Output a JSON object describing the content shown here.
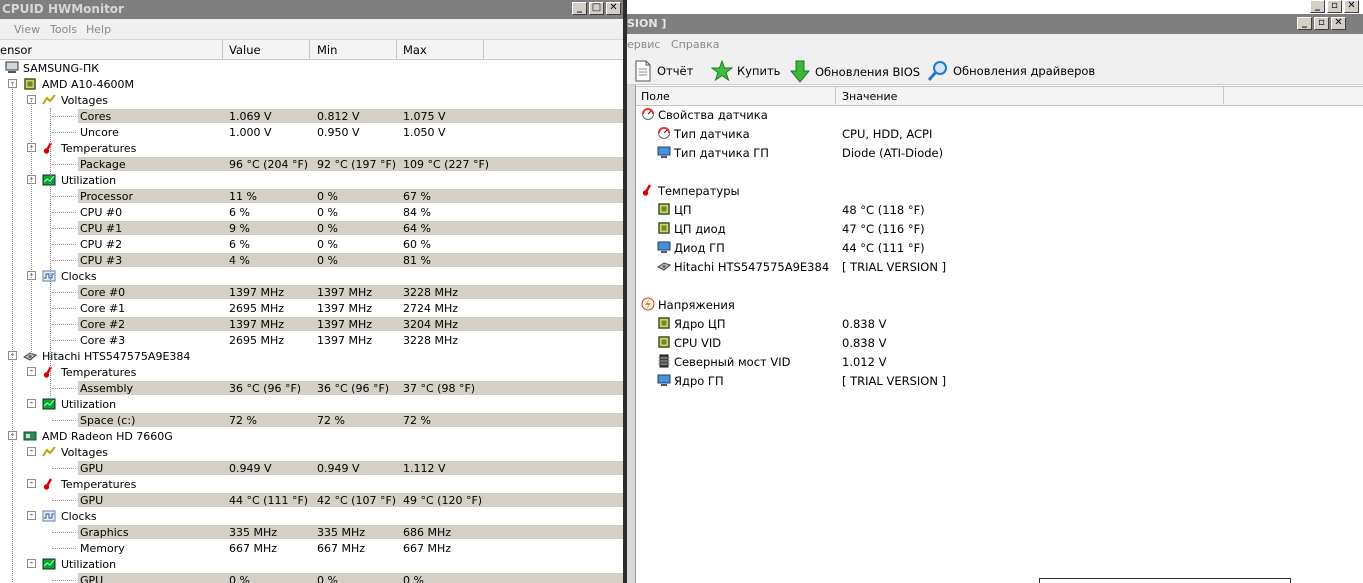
{
  "hwmonitor": {
    "title": "CPUID HWMonitor",
    "menu": [
      "View",
      "Tools",
      "Help"
    ],
    "columns": [
      "ensor",
      "Value",
      "Min",
      "Max"
    ],
    "rows": [
      {
        "level": 0,
        "icon": "computer-icon",
        "label": "SAMSUNG-ПК"
      },
      {
        "level": 1,
        "icon": "cpu-chip-icon",
        "label": "AMD A10-4600M",
        "toggle": "-"
      },
      {
        "level": 2,
        "icon": "voltage-icon",
        "label": "Voltages",
        "toggle": "-"
      },
      {
        "level": 3,
        "label": "Cores",
        "value": "1.069 V",
        "min": "0.812 V",
        "max": "1.075 V",
        "shade": true
      },
      {
        "level": 3,
        "label": "Uncore",
        "value": "1.000 V",
        "min": "0.950 V",
        "max": "1.050 V"
      },
      {
        "level": 2,
        "icon": "thermometer-icon",
        "label": "Temperatures",
        "toggle": "-"
      },
      {
        "level": 3,
        "label": "Package",
        "value": "96 °C  (204 °F)",
        "min": "92 °C  (197 °F)",
        "max": "109 °C  (227 °F)",
        "shade": true
      },
      {
        "level": 2,
        "icon": "utilization-icon",
        "label": "Utilization",
        "toggle": "-"
      },
      {
        "level": 3,
        "label": "Processor",
        "value": "11 %",
        "min": "0 %",
        "max": "67 %",
        "shade": true
      },
      {
        "level": 3,
        "label": "CPU #0",
        "value": "6 %",
        "min": "0 %",
        "max": "84 %"
      },
      {
        "level": 3,
        "label": "CPU #1",
        "value": "9 %",
        "min": "0 %",
        "max": "64 %",
        "shade": true
      },
      {
        "level": 3,
        "label": "CPU #2",
        "value": "6 %",
        "min": "0 %",
        "max": "60 %"
      },
      {
        "level": 3,
        "label": "CPU #3",
        "value": "4 %",
        "min": "0 %",
        "max": "81 %",
        "shade": true
      },
      {
        "level": 2,
        "icon": "clock-icon",
        "label": "Clocks",
        "toggle": "-"
      },
      {
        "level": 3,
        "label": "Core #0",
        "value": "1397 MHz",
        "min": "1397 MHz",
        "max": "3228 MHz",
        "shade": true
      },
      {
        "level": 3,
        "label": "Core #1",
        "value": "2695 MHz",
        "min": "1397 MHz",
        "max": "2724 MHz"
      },
      {
        "level": 3,
        "label": "Core #2",
        "value": "1397 MHz",
        "min": "1397 MHz",
        "max": "3204 MHz",
        "shade": true
      },
      {
        "level": 3,
        "label": "Core #3",
        "value": "2695 MHz",
        "min": "1397 MHz",
        "max": "3228 MHz"
      },
      {
        "level": 1,
        "icon": "hard-drive-icon",
        "label": "Hitachi HTS547575A9E384",
        "toggle": "-"
      },
      {
        "level": 2,
        "icon": "thermometer-icon",
        "label": "Temperatures",
        "toggle": "-"
      },
      {
        "level": 3,
        "label": "Assembly",
        "value": "36 °C  (96 °F)",
        "min": "36 °C  (96 °F)",
        "max": "37 °C  (98 °F)",
        "shade": true
      },
      {
        "level": 2,
        "icon": "utilization-icon",
        "label": "Utilization",
        "toggle": "-"
      },
      {
        "level": 3,
        "label": "Space (c:)",
        "value": "72 %",
        "min": "72 %",
        "max": "72 %",
        "shade": true
      },
      {
        "level": 1,
        "icon": "gpu-card-icon",
        "label": "AMD Radeon HD 7660G",
        "toggle": "-"
      },
      {
        "level": 2,
        "icon": "voltage-icon",
        "label": "Voltages",
        "toggle": "-"
      },
      {
        "level": 3,
        "label": "GPU",
        "value": "0.949 V",
        "min": "0.949 V",
        "max": "1.112 V",
        "shade": true
      },
      {
        "level": 2,
        "icon": "thermometer-icon",
        "label": "Temperatures",
        "toggle": "-"
      },
      {
        "level": 3,
        "label": "GPU",
        "value": "44 °C  (111 °F)",
        "min": "42 °C  (107 °F)",
        "max": "49 °C  (120 °F)",
        "shade": true
      },
      {
        "level": 2,
        "icon": "clock-icon",
        "label": "Clocks",
        "toggle": "-"
      },
      {
        "level": 3,
        "label": "Graphics",
        "value": "335 MHz",
        "min": "335 MHz",
        "max": "686 MHz",
        "shade": true
      },
      {
        "level": 3,
        "label": "Memory",
        "value": "667 MHz",
        "min": "667 MHz",
        "max": "667 MHz"
      },
      {
        "level": 2,
        "icon": "utilization-icon",
        "label": "Utilization",
        "toggle": "-"
      },
      {
        "level": 3,
        "label": "GPU",
        "value": "0 %",
        "min": "0 %",
        "max": "0 %",
        "shade": true
      }
    ]
  },
  "aida": {
    "title": "SION ]",
    "menu": [
      "ервис",
      "Справка"
    ],
    "toolbar": [
      {
        "icon": "report-icon",
        "label": "Отчёт"
      },
      {
        "icon": "buy-icon",
        "label": "Купить"
      },
      {
        "icon": "bios-update-icon",
        "label": "Обновления BIOS"
      },
      {
        "icon": "driver-update-icon",
        "label": "Обновления драйверов"
      }
    ],
    "columns": [
      "Поле",
      "Значение"
    ],
    "rows": [
      {
        "type": "group",
        "icon": "gauge-icon",
        "label": "Свойства датчика"
      },
      {
        "type": "item",
        "icon": "gauge-icon",
        "label": "Тип датчика",
        "value": "CPU, HDD, ACPI"
      },
      {
        "type": "item",
        "icon": "monitor-icon",
        "label": "Тип датчика ГП",
        "value": "Diode  (ATI-Diode)"
      },
      {
        "type": "spacer"
      },
      {
        "type": "group",
        "icon": "thermometer-icon",
        "label": "Температуры"
      },
      {
        "type": "item",
        "icon": "cpu-chip-icon",
        "label": "ЦП",
        "value": "48 °C  (118 °F)"
      },
      {
        "type": "item",
        "icon": "cpu-chip-icon",
        "label": "ЦП диод",
        "value": "47 °C  (116 °F)"
      },
      {
        "type": "item",
        "icon": "monitor-icon",
        "label": "Диод ГП",
        "value": "44 °C  (111 °F)"
      },
      {
        "type": "item",
        "icon": "hard-drive-icon",
        "label": "Hitachi HTS547575A9E384",
        "value": "[ TRIAL VERSION ]"
      },
      {
        "type": "spacer"
      },
      {
        "type": "group",
        "icon": "lightning-icon",
        "label": "Напряжения"
      },
      {
        "type": "item",
        "icon": "cpu-chip-icon",
        "label": "Ядро ЦП",
        "value": "0.838 V"
      },
      {
        "type": "item",
        "icon": "cpu-chip-icon",
        "label": "CPU VID",
        "value": "0.838 V"
      },
      {
        "type": "item",
        "icon": "chipset-icon",
        "label": "Северный мост VID",
        "value": "1.012 V"
      },
      {
        "type": "item",
        "icon": "monitor-icon",
        "label": "Ядро ГП",
        "value": "[ TRIAL VERSION ]"
      }
    ]
  }
}
